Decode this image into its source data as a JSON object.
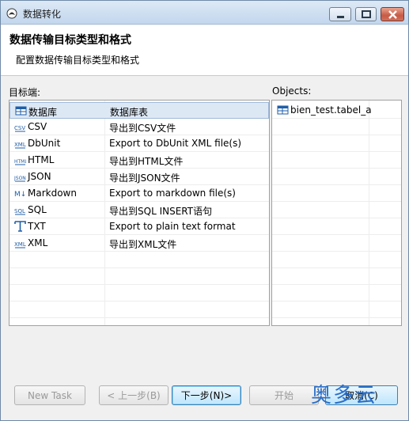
{
  "window": {
    "title": "数据转化"
  },
  "header": {
    "title": "数据传输目标类型和格式",
    "description": "配置数据传输目标类型和格式"
  },
  "left": {
    "label": "目标端:",
    "items": [
      {
        "icon": "database-table-icon",
        "name": "数据库",
        "desc": "数据库表",
        "selected": true
      },
      {
        "icon": "csv-file-icon",
        "name": "CSV",
        "desc": "导出到CSV文件"
      },
      {
        "icon": "xml-file-icon",
        "name": "DbUnit",
        "desc": "Export to DbUnit XML file(s)"
      },
      {
        "icon": "html-file-icon",
        "name": "HTML",
        "desc": "导出到HTML文件"
      },
      {
        "icon": "json-file-icon",
        "name": "JSON",
        "desc": "导出到JSON文件"
      },
      {
        "icon": "markdown-icon",
        "name": "Markdown",
        "desc": "Export to markdown file(s)"
      },
      {
        "icon": "sql-file-icon",
        "name": "SQL",
        "desc": "导出到SQL INSERT语句"
      },
      {
        "icon": "text-format-icon",
        "name": "TXT",
        "desc": "Export to plain text format"
      },
      {
        "icon": "xml-file-icon",
        "name": "XML",
        "desc": "导出到XML文件"
      }
    ]
  },
  "right": {
    "label": "Objects:",
    "items": [
      {
        "icon": "table-icon",
        "name": "bien_test.tabel_a"
      }
    ]
  },
  "buttons": {
    "new_task": "New Task",
    "back": "< 上一步(B)",
    "next": "下一步(N)>",
    "start": "开始",
    "cancel": "取消(C)"
  },
  "watermark": "奥多云",
  "colors": {
    "selected_row": "#dde8f5",
    "accent": "#1f5ea8"
  }
}
